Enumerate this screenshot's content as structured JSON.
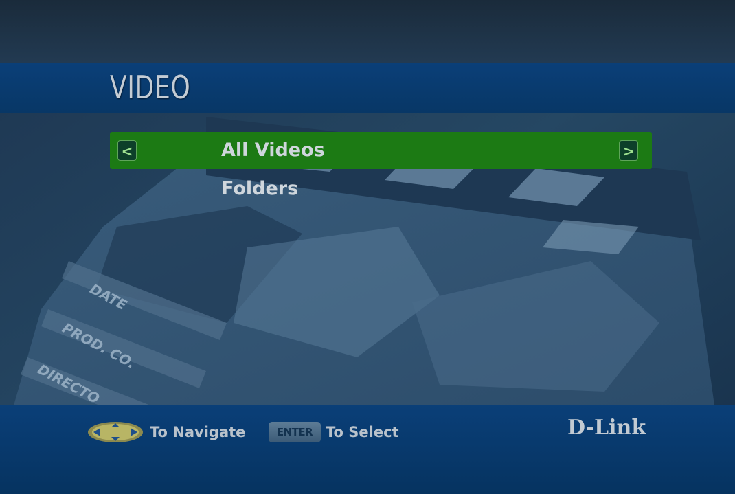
{
  "page": {
    "title": "VIDEO"
  },
  "menu": {
    "items": [
      {
        "label": "All Videos",
        "selected": true
      },
      {
        "label": "Folders",
        "selected": false
      }
    ],
    "left_arrow": "<",
    "right_arrow": ">"
  },
  "background": {
    "slate_labels": [
      "DATE",
      "PROD. CO.",
      "DIRECTO"
    ]
  },
  "footer": {
    "navigate_hint": "To Navigate",
    "enter_key_label": "ENTER",
    "select_hint": "To Select",
    "brand": "D-Link",
    "nav_pad_icon": "directional-pad-icon"
  },
  "colors": {
    "band_blue": "#0a3f78",
    "selection_green": "#1c7a14",
    "background_dark": "#0f2236",
    "text_light": "#cfd6dc"
  }
}
